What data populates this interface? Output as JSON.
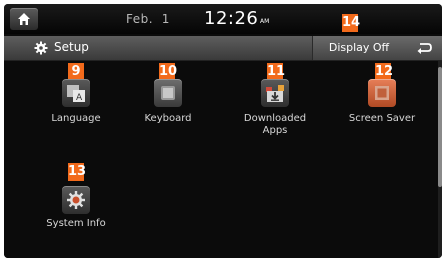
{
  "status_bar": {
    "date": "Feb.  1",
    "time": "12:26",
    "ampm": "AM"
  },
  "title_bar": {
    "title": "Setup",
    "display_off_label": "Display Off"
  },
  "items": [
    {
      "label": "Language",
      "badge": "9",
      "icon": "language-icon"
    },
    {
      "label": "Keyboard",
      "badge": "10",
      "icon": "keyboard-icon"
    },
    {
      "label": "Downloaded Apps",
      "badge": "11",
      "icon": "downloaded-apps-icon"
    },
    {
      "label": "Screen Saver",
      "badge": "12",
      "icon": "screen-saver-icon"
    },
    {
      "label": "System Info",
      "badge": "13",
      "icon": "system-info-icon"
    }
  ],
  "callouts": {
    "display_off_badge": "14"
  },
  "colors": {
    "badge": "#f26a1b",
    "background": "#0b0b0b"
  }
}
